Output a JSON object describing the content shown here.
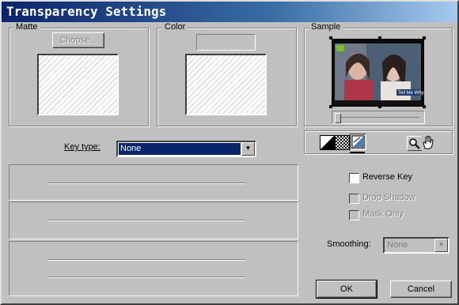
{
  "window": {
    "title": "Transparency Settings"
  },
  "matte": {
    "label": "Matte",
    "choose_button": "Choose..."
  },
  "color": {
    "label": "Color"
  },
  "sample": {
    "label": "Sample",
    "image_caption": "Tell Me Why",
    "tools": [
      "black-white-background-icon",
      "checkerboard-background-icon",
      "key-out-background-icon",
      "zoom-icon",
      "hand-icon"
    ]
  },
  "key_type": {
    "label": "Key type:",
    "value": "None"
  },
  "options": {
    "reverse_key": {
      "label": "Reverse Key",
      "checked": false,
      "enabled": true
    },
    "drop_shadow": {
      "label": "Drop Shadow",
      "checked": false,
      "enabled": false
    },
    "mask_only": {
      "label": "Mask Only",
      "checked": false,
      "enabled": false
    }
  },
  "smoothing": {
    "label": "Smoothing:",
    "value": "None"
  },
  "buttons": {
    "ok": "OK",
    "cancel": "Cancel"
  }
}
